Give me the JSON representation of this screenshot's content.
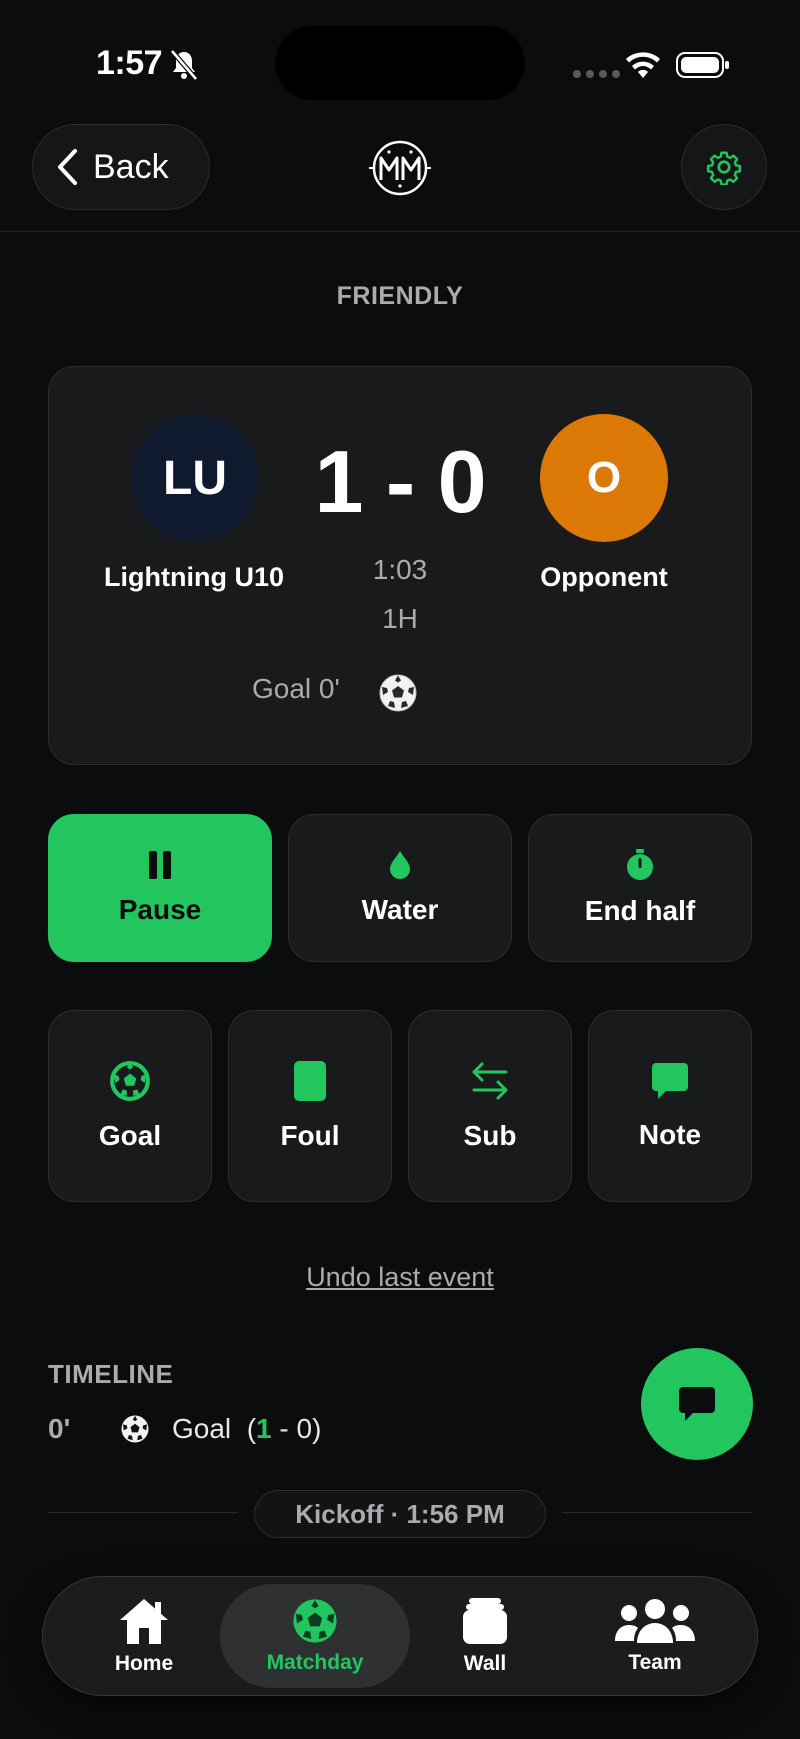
{
  "status_bar": {
    "time": "1:57"
  },
  "header": {
    "back_label": "Back"
  },
  "match": {
    "type": "FRIENDLY",
    "home": {
      "initials": "LU",
      "name": "Lightning U10",
      "color": "#0f1a2e"
    },
    "away": {
      "initials": "O",
      "name": "Opponent",
      "color": "#dc7906"
    },
    "score": "1 - 0",
    "clock": "1:03",
    "period": "1H",
    "last_event": "Goal 0'"
  },
  "controls": {
    "pause": "Pause",
    "water": "Water",
    "end_half": "End half"
  },
  "events": {
    "goal": "Goal",
    "foul": "Foul",
    "sub": "Sub",
    "note": "Note"
  },
  "undo_label": "Undo last event",
  "timeline": {
    "title": "TIMELINE",
    "items": [
      {
        "minute": "0'",
        "label": "Goal",
        "score_home": "1",
        "score_sep": " - ",
        "score_away": "0"
      }
    ],
    "kickoff": "Kickoff · 1:56 PM"
  },
  "tabs": {
    "home": "Home",
    "matchday": "Matchday",
    "wall": "Wall",
    "team": "Team"
  },
  "colors": {
    "accent": "#22c55e",
    "background": "#0b0c0d",
    "card": "#191a1b"
  }
}
